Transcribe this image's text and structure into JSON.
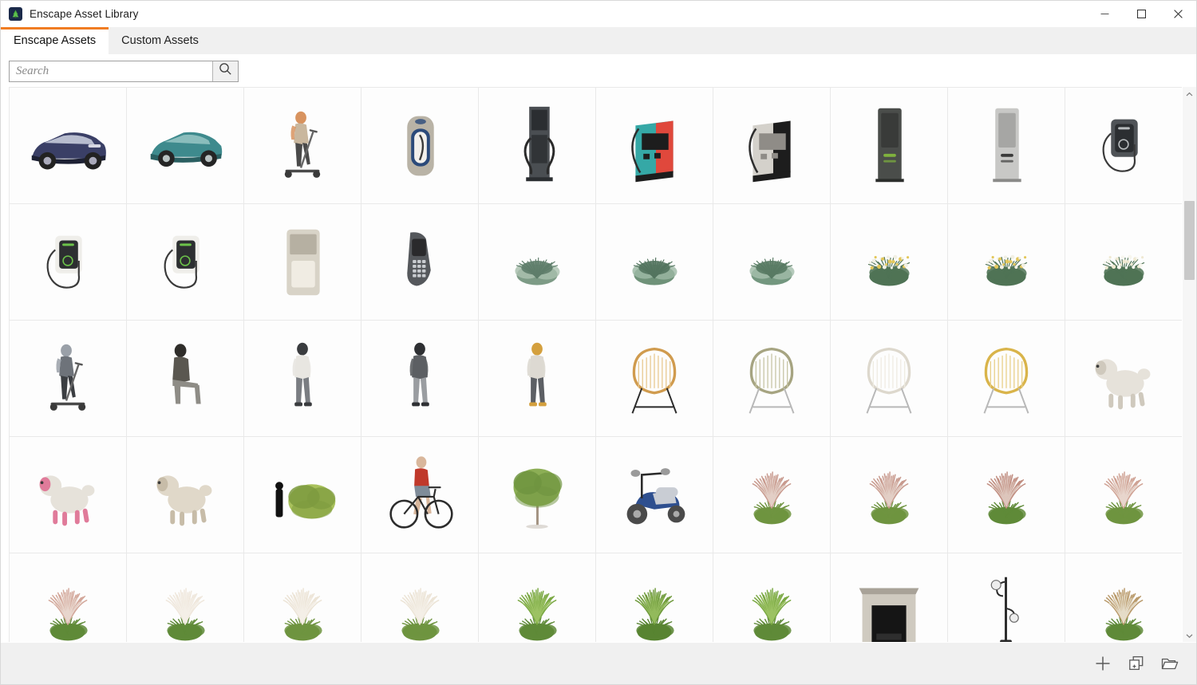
{
  "window": {
    "title": "Enscape Asset Library",
    "logo_icon": "enscape-tree-logo",
    "controls": [
      {
        "name": "minimize-button",
        "icon": "minimize-icon",
        "label": "Minimize"
      },
      {
        "name": "maximize-button",
        "icon": "maximize-icon",
        "label": "Maximize"
      },
      {
        "name": "close-button",
        "icon": "close-icon",
        "label": "Close"
      }
    ]
  },
  "tabs": [
    {
      "label": "Enscape Assets",
      "active": true
    },
    {
      "label": "Custom Assets",
      "active": false
    }
  ],
  "accent_color": "#f07c22",
  "search": {
    "value": "",
    "placeholder": "Search",
    "button_icon": "search-icon",
    "button_label": "Search"
  },
  "scrollbar": {
    "up_icon": "chevron-up-icon",
    "down_icon": "chevron-down-icon",
    "thumb_top_pct": 19,
    "thumb_height_pct": 15
  },
  "bottom_toolbar": [
    {
      "name": "add-asset-button",
      "icon": "plus-icon",
      "label": "Add"
    },
    {
      "name": "duplicate-asset-button",
      "icon": "duplicate-plus-icon",
      "label": "Add from file"
    },
    {
      "name": "open-folder-button",
      "icon": "open-folder-icon",
      "label": "Open folder"
    }
  ],
  "grid": {
    "columns": 10,
    "items": [
      {
        "id": "a1",
        "name": "electric-suv-dark-blue",
        "kind": "vehicle-suv",
        "colors": [
          "#3a3f66",
          "#cfd3e2",
          "#1d2134"
        ]
      },
      {
        "id": "a2",
        "name": "electric-city-car-teal",
        "kind": "vehicle-hatch",
        "colors": [
          "#3e8a8d",
          "#9ec9c8",
          "#2a5f61"
        ]
      },
      {
        "id": "a3",
        "name": "woman-on-e-scooter",
        "kind": "person-scooter",
        "colors": [
          "#d8935f",
          "#c9b79e",
          "#4a4a4a"
        ]
      },
      {
        "id": "a4",
        "name": "ev-charging-post-beige-blue",
        "kind": "charger-post",
        "colors": [
          "#b9b3a6",
          "#2b4a7a",
          "#e2ded4"
        ]
      },
      {
        "id": "a5",
        "name": "ev-charging-column-dark",
        "kind": "charger-column",
        "colors": [
          "#4a4e52",
          "#2b2e31",
          "#9aa0a5"
        ]
      },
      {
        "id": "a6",
        "name": "ev-fast-charger-teal-red",
        "kind": "charger-box",
        "colors": [
          "#35a8a6",
          "#e0483c",
          "#1d1d1d"
        ]
      },
      {
        "id": "a7",
        "name": "ev-fast-charger-grey",
        "kind": "charger-box",
        "colors": [
          "#d4d1cb",
          "#1d1d1d",
          "#8f8c87"
        ]
      },
      {
        "id": "a8",
        "name": "ev-charging-pillar-green",
        "kind": "charger-pillar",
        "colors": [
          "#4a4d4a",
          "#7fb23d",
          "#2c2e2c"
        ]
      },
      {
        "id": "a9",
        "name": "ev-charging-pillar-slim",
        "kind": "charger-pillar",
        "colors": [
          "#c8c8c6",
          "#3a3a3a",
          "#8a8a88"
        ]
      },
      {
        "id": "a10",
        "name": "ev-wallbox-charger-dark",
        "kind": "charger-wall",
        "colors": [
          "#4f5357",
          "#2b2e31",
          "#b7bbbd"
        ]
      },
      {
        "id": "b1",
        "name": "ev-wallbox-charger-cable",
        "kind": "charger-wall",
        "colors": [
          "#efeeea",
          "#2d2f31",
          "#6cc24a"
        ]
      },
      {
        "id": "b2",
        "name": "ev-wallbox-charger-small",
        "kind": "charger-wall",
        "colors": [
          "#efeeea",
          "#2d2f31",
          "#6cc24a"
        ]
      },
      {
        "id": "b3",
        "name": "air-cooler-unit",
        "kind": "appliance",
        "colors": [
          "#d8d3c7",
          "#b6b0a2",
          "#f0ece3"
        ]
      },
      {
        "id": "b4",
        "name": "cordless-phone-handset",
        "kind": "electronics",
        "colors": [
          "#2a2a2c",
          "#55585c",
          "#c9ccd0"
        ]
      },
      {
        "id": "b5",
        "name": "shrub-low-sage",
        "kind": "plant-shrub",
        "colors": [
          "#7d9b86",
          "#a9c0ae",
          "#5e7d6a"
        ]
      },
      {
        "id": "b6",
        "name": "shrub-wide-sage",
        "kind": "plant-shrub",
        "colors": [
          "#6f9279",
          "#9cb8a4",
          "#53745f"
        ]
      },
      {
        "id": "b7",
        "name": "shrub-small-sage",
        "kind": "plant-shrub",
        "colors": [
          "#73977f",
          "#a3bdaa",
          "#587a63"
        ]
      },
      {
        "id": "b8",
        "name": "flowering-plant-yellow-wide",
        "kind": "plant-flower",
        "colors": [
          "#4f7355",
          "#e3c75a",
          "#f2f0e4"
        ]
      },
      {
        "id": "b9",
        "name": "flowering-plant-yellow-medium",
        "kind": "plant-flower",
        "colors": [
          "#4f7355",
          "#e3c75a",
          "#f2f0e4"
        ]
      },
      {
        "id": "b10",
        "name": "flowering-plant-white-tuft",
        "kind": "plant-flower",
        "colors": [
          "#4f7355",
          "#efe9d2",
          "#f7f6ee"
        ]
      },
      {
        "id": "c1",
        "name": "man-on-e-scooter",
        "kind": "person-scooter",
        "colors": [
          "#9aa0a8",
          "#6e737a",
          "#3b3e42"
        ]
      },
      {
        "id": "c2",
        "name": "man-seated-suit",
        "kind": "person-seated",
        "colors": [
          "#8e8c86",
          "#5a5750",
          "#2f2d2a"
        ]
      },
      {
        "id": "c3",
        "name": "man-standing-casual",
        "kind": "person-standing",
        "colors": [
          "#e8e6e1",
          "#7a7d82",
          "#3a3c3f"
        ]
      },
      {
        "id": "c4",
        "name": "man-standing-jacket",
        "kind": "person-standing",
        "colors": [
          "#5c5f63",
          "#9a9da1",
          "#2e3033"
        ]
      },
      {
        "id": "c5",
        "name": "man-standing-phone",
        "kind": "person-standing",
        "colors": [
          "#ddd9d2",
          "#5c5f64",
          "#d4a03e"
        ]
      },
      {
        "id": "c6",
        "name": "rattan-lounge-chair",
        "kind": "furniture-chair",
        "colors": [
          "#d09b4e",
          "#e8c88e",
          "#2b2b2b"
        ]
      },
      {
        "id": "c7",
        "name": "drop-chair-olive",
        "kind": "furniture-chair",
        "colors": [
          "#a6a481",
          "#c6c4a4",
          "#b8b8b8"
        ]
      },
      {
        "id": "c8",
        "name": "drop-chair-cream",
        "kind": "furniture-chair",
        "colors": [
          "#ddd8cd",
          "#efebe2",
          "#b8b8b8"
        ]
      },
      {
        "id": "c9",
        "name": "drop-chair-mustard",
        "kind": "furniture-chair",
        "colors": [
          "#d9b44a",
          "#e8cf86",
          "#b8b8b8"
        ]
      },
      {
        "id": "c10",
        "name": "dog-poodle-standing",
        "kind": "animal-dog",
        "colors": [
          "#e6e2da",
          "#cfc9bd",
          "#8d8madd"
        ]
      },
      {
        "id": "d1",
        "name": "dog-poodle-pink-coat",
        "kind": "animal-dog",
        "colors": [
          "#e6e2da",
          "#e07b9a",
          "#cfc9bd"
        ]
      },
      {
        "id": "d2",
        "name": "dog-poodle-lying",
        "kind": "animal-dog",
        "colors": [
          "#e0d8c9",
          "#c7bca8",
          "#a89b85"
        ]
      },
      {
        "id": "d3",
        "name": "bush-with-scale-figure",
        "kind": "plant-bush",
        "colors": [
          "#a9c15c",
          "#7d9a3e",
          "#111111"
        ]
      },
      {
        "id": "d4",
        "name": "man-with-bicycle",
        "kind": "person-bicycle",
        "colors": [
          "#c0392b",
          "#7f8c99",
          "#2c2c2c"
        ]
      },
      {
        "id": "d5",
        "name": "deciduous-tree-with-scale",
        "kind": "plant-tree",
        "colors": [
          "#8cae55",
          "#6f9440",
          "#a39382"
        ]
      },
      {
        "id": "d6",
        "name": "electric-moped-blue",
        "kind": "vehicle-moped",
        "colors": [
          "#2e4f8f",
          "#c9cdd4",
          "#2b2b2b"
        ]
      },
      {
        "id": "d7",
        "name": "ornamental-grass-pink-plumes",
        "kind": "plant-grass",
        "colors": [
          "#c89a8e",
          "#6f9440",
          "#e3cfc6"
        ]
      },
      {
        "id": "d8",
        "name": "ornamental-grass-tall-plumes",
        "kind": "plant-grass",
        "colors": [
          "#c89a8e",
          "#6f9440",
          "#e3cfc6"
        ]
      },
      {
        "id": "d9",
        "name": "ornamental-grass-compact",
        "kind": "plant-grass",
        "colors": [
          "#c08d80",
          "#5f8a38",
          "#ddc6bc"
        ]
      },
      {
        "id": "d10",
        "name": "ornamental-grass-spray",
        "kind": "plant-grass",
        "colors": [
          "#cfa294",
          "#6f9440",
          "#e8d6cd"
        ]
      },
      {
        "id": "e1",
        "name": "ornamental-grass-pink-low",
        "kind": "plant-grass",
        "colors": [
          "#d3a79a",
          "#5f8a38",
          "#e8d6cd"
        ]
      },
      {
        "id": "e2",
        "name": "ornamental-grass-white-plumes",
        "kind": "plant-grass",
        "colors": [
          "#efe7dc",
          "#5f8a38",
          "#f4efe7"
        ]
      },
      {
        "id": "e3",
        "name": "ornamental-grass-cream-thin",
        "kind": "plant-grass",
        "colors": [
          "#ece4d6",
          "#6f9440",
          "#f4efe7"
        ]
      },
      {
        "id": "e4",
        "name": "ornamental-grass-cream-wide",
        "kind": "plant-grass",
        "colors": [
          "#ece4d6",
          "#6f9440",
          "#f4efe7"
        ]
      },
      {
        "id": "e5",
        "name": "ornamental-grass-green-tuft",
        "kind": "plant-grass",
        "colors": [
          "#7aa843",
          "#5f8a38",
          "#9cc263"
        ]
      },
      {
        "id": "e6",
        "name": "ornamental-grass-green-wide",
        "kind": "plant-grass",
        "colors": [
          "#6f9a3c",
          "#588431",
          "#93ba5c"
        ]
      },
      {
        "id": "e7",
        "name": "ornamental-grass-green-round",
        "kind": "plant-grass",
        "colors": [
          "#7aa843",
          "#5f8a38",
          "#9cc263"
        ]
      },
      {
        "id": "e8",
        "name": "fireplace-mantel",
        "kind": "furniture-fireplace",
        "colors": [
          "#cfcac0",
          "#151515",
          "#a8a298"
        ]
      },
      {
        "id": "e9",
        "name": "street-lamp-post",
        "kind": "lighting-streetlamp",
        "colors": [
          "#2b2b2b",
          "#ededed",
          "#6a6a6a"
        ]
      },
      {
        "id": "e10",
        "name": "ornamental-grass-seed-heads",
        "kind": "plant-grass",
        "colors": [
          "#b99a6b",
          "#5f8a38",
          "#e5dcc8"
        ]
      }
    ]
  }
}
